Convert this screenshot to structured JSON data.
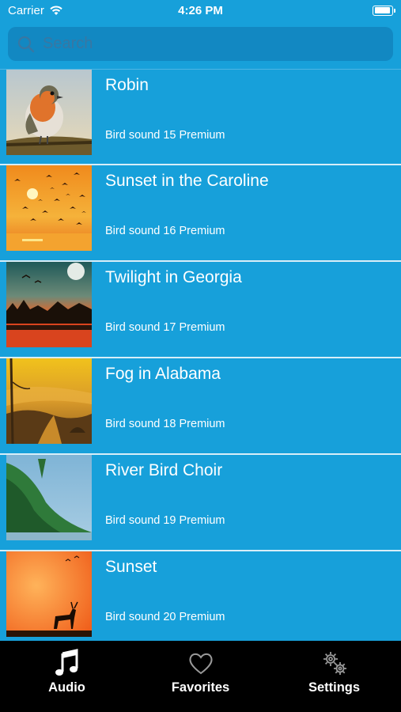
{
  "status_bar": {
    "carrier": "Carrier",
    "time": "4:26 PM",
    "battery_level": 0.95
  },
  "search": {
    "placeholder": "Search",
    "value": ""
  },
  "items": [
    {
      "title": "Robin",
      "subtitle": "Bird sound 15 Premium",
      "thumb": "robin"
    },
    {
      "title": "Sunset in the Caroline",
      "subtitle": "Bird sound 16 Premium",
      "thumb": "sunset-birds"
    },
    {
      "title": "Twilight in Georgia",
      "subtitle": "Bird sound 17 Premium",
      "thumb": "twilight"
    },
    {
      "title": "Fog in Alabama",
      "subtitle": "Bird sound 18 Premium",
      "thumb": "fog"
    },
    {
      "title": "River Bird Choir",
      "subtitle": "Bird sound 19 Premium",
      "thumb": "river"
    },
    {
      "title": "Sunset",
      "subtitle": "Bird sound 20 Premium",
      "thumb": "sunset-deer"
    }
  ],
  "tabbar": {
    "tabs": [
      {
        "label": "Audio",
        "icon": "music-note-icon",
        "active": true
      },
      {
        "label": "Favorites",
        "icon": "heart-icon",
        "active": false
      },
      {
        "label": "Settings",
        "icon": "gears-icon",
        "active": false
      }
    ]
  },
  "colors": {
    "background": "#17a0da",
    "search_bg": "#1288c2",
    "tabbar_bg": "#000000"
  }
}
